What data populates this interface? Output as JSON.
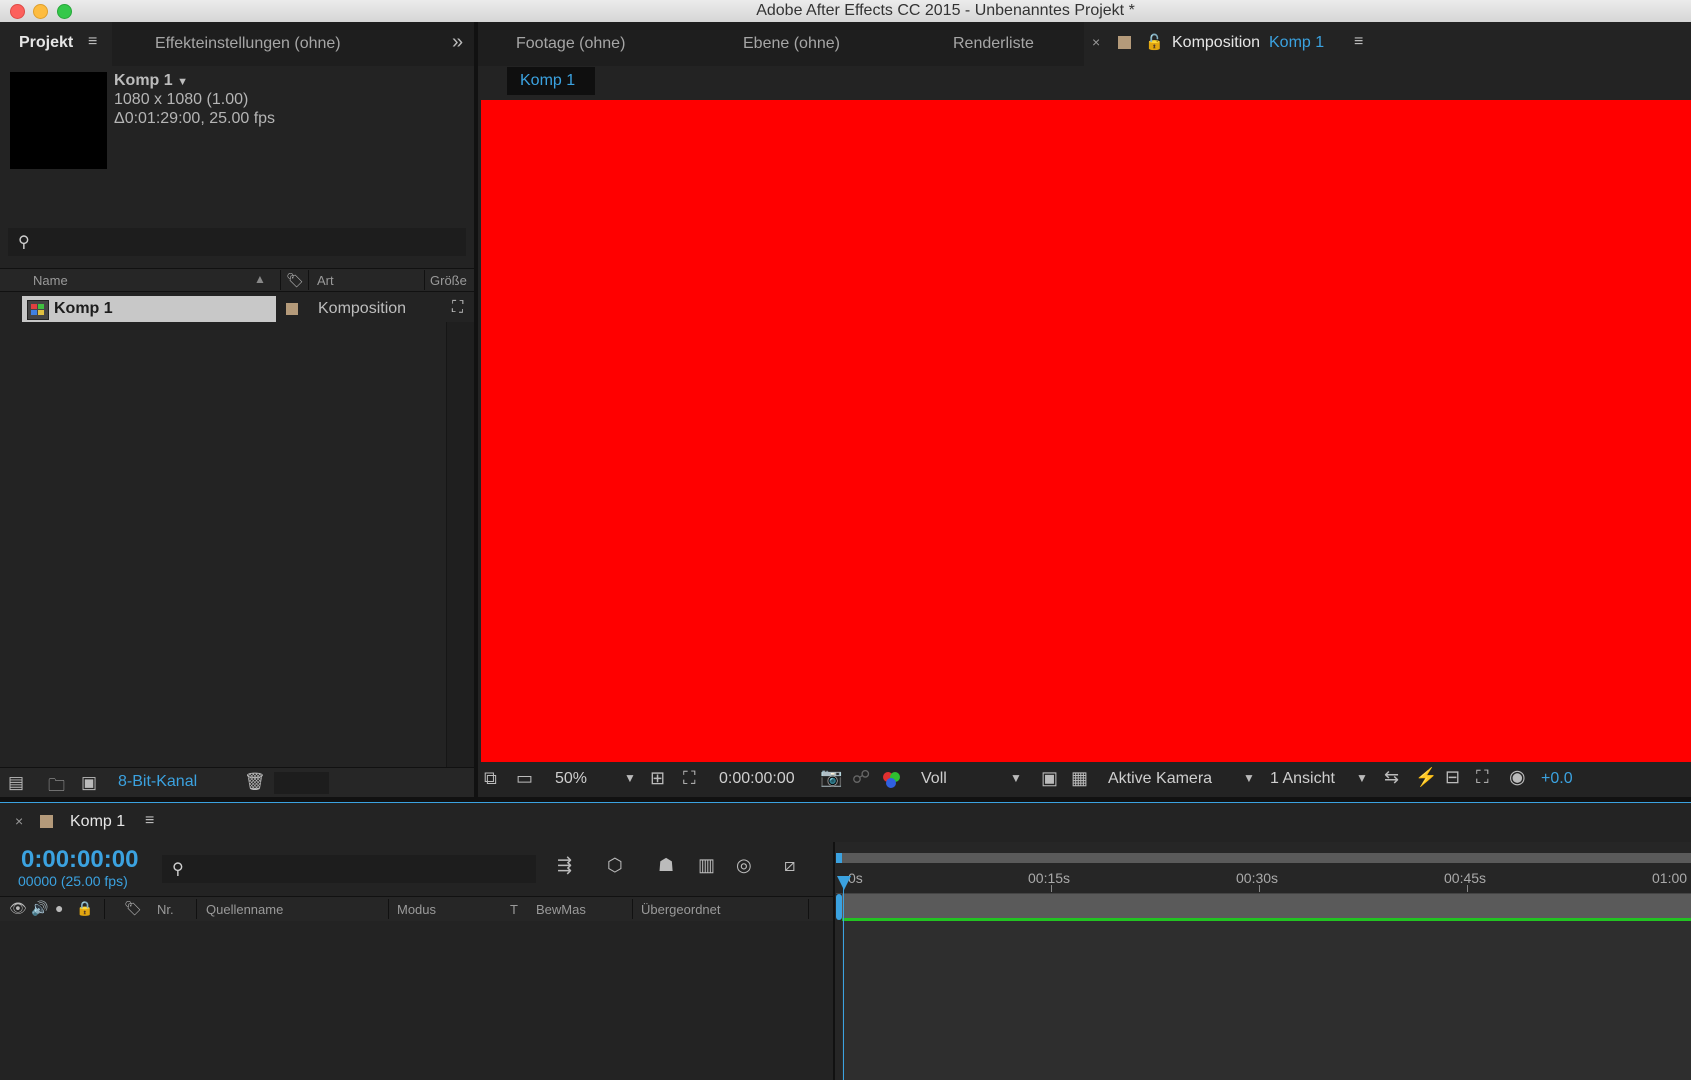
{
  "window": {
    "title": "Adobe After Effects CC 2015 - Unbenanntes Projekt *"
  },
  "left_tabs": {
    "project": "Projekt",
    "effects": "Effekteinstellungen (ohne)"
  },
  "right_tabs": {
    "footage": "Footage (ohne)",
    "layer": "Ebene (ohne)",
    "render": "Renderliste",
    "comp_prefix": "Komposition",
    "comp_name": "Komp 1"
  },
  "project": {
    "comp_title": "Komp 1",
    "comp_size": "1080 x 1080 (1.00)",
    "comp_duration": "Δ0:01:29:00, 25.00 fps",
    "search_placeholder": "",
    "columns": {
      "name": "Name",
      "type": "Art",
      "size": "Größe"
    },
    "items": [
      {
        "name": "Komp 1",
        "type": "Komposition",
        "label_color": "#b49a7a"
      }
    ],
    "bit_depth": "8-Bit-Kanal"
  },
  "viewer": {
    "breadcrumb": "Komp 1",
    "background_color": "#ff0000",
    "zoom": "50%",
    "timecode": "0:00:00:00",
    "resolution": "Voll",
    "camera": "Aktive Kamera",
    "views": "1 Ansicht",
    "exposure": "+0.0"
  },
  "timeline": {
    "tab": "Komp 1",
    "timecode": "0:00:00:00",
    "frames": "00000 (25.00 fps)",
    "columns": {
      "nr": "Nr.",
      "source": "Quellenname",
      "mode": "Modus",
      "t": "T",
      "trkmat": "BewMas",
      "parent": "Übergeordnet"
    },
    "ruler": [
      "0s",
      "00:15s",
      "00:30s",
      "00:45s",
      "01:00"
    ]
  },
  "colors": {
    "accent": "#3ba2e0",
    "workarea": "#22c322",
    "panel": "#232323"
  }
}
